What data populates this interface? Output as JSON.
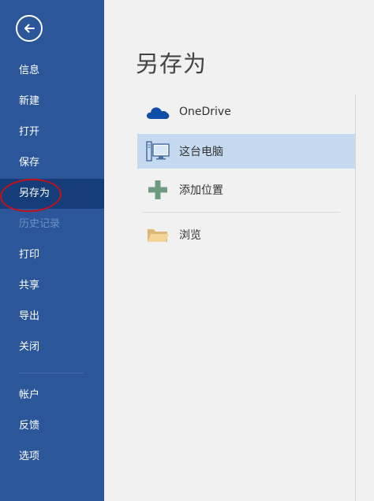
{
  "sidebar": {
    "back_icon": "back-arrow-icon",
    "items": [
      {
        "label": "信息"
      },
      {
        "label": "新建"
      },
      {
        "label": "打开"
      },
      {
        "label": "保存"
      },
      {
        "label": "另存为"
      },
      {
        "label": "历史记录"
      },
      {
        "label": "打印"
      },
      {
        "label": "共享"
      },
      {
        "label": "导出"
      },
      {
        "label": "关闭"
      },
      {
        "label": "帐户"
      },
      {
        "label": "反馈"
      },
      {
        "label": "选项"
      }
    ],
    "active_item": "另存为",
    "disabled_item": "历史记录"
  },
  "main": {
    "title": "另存为",
    "locations": [
      {
        "label": "OneDrive",
        "icon": "onedrive-cloud-icon"
      },
      {
        "label": "这台电脑",
        "icon": "this-pc-icon"
      },
      {
        "label": "添加位置",
        "icon": "add-place-icon"
      },
      {
        "label": "浏览",
        "icon": "folder-icon"
      }
    ],
    "selected_location": "这台电脑"
  },
  "colors": {
    "sidebar_bg": "#2b579a",
    "sidebar_active": "#143d7a",
    "selected_bg": "#c5d9f1",
    "annotation": "#c0121b"
  }
}
